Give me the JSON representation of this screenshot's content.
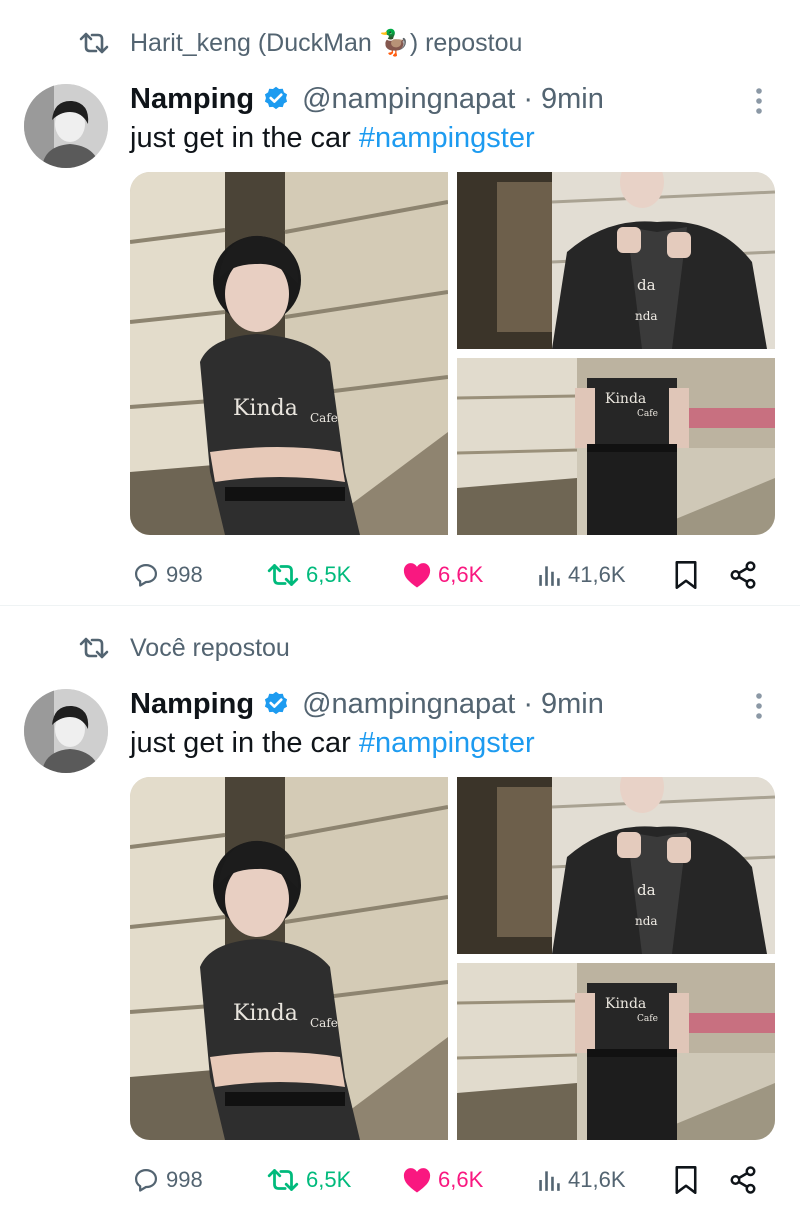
{
  "colors": {
    "accent_blue": "#1d9bf0",
    "repost_green": "#00ba7c",
    "like_pink": "#f91880",
    "secondary_text": "#536471"
  },
  "tweets": [
    {
      "repost_label": "Harit_keng (DuckMan 🦆) repostou",
      "author": {
        "name": "Namping",
        "handle": "@nampingnapat",
        "separator": "·",
        "time": "9min",
        "verified_icon": "verified-badge-icon"
      },
      "text_plain": "just get in the car ",
      "hashtag": "#nampingster",
      "photo_texts": [
        "Kinda",
        "Cafe",
        "da",
        "nda"
      ],
      "actions": {
        "replies": "998",
        "reposts": "6,5K",
        "likes": "6,6K",
        "views": "41,6K"
      }
    },
    {
      "repost_label": "Você repostou",
      "author": {
        "name": "Namping",
        "handle": "@nampingnapat",
        "separator": "·",
        "time": "9min",
        "verified_icon": "verified-badge-icon"
      },
      "text_plain": "just get in the car ",
      "hashtag": "#nampingster",
      "photo_texts": [
        "Kinda",
        "Cafe",
        "da",
        "nda"
      ],
      "actions": {
        "replies": "998",
        "reposts": "6,5K",
        "likes": "6,6K",
        "views": "41,6K"
      }
    }
  ]
}
